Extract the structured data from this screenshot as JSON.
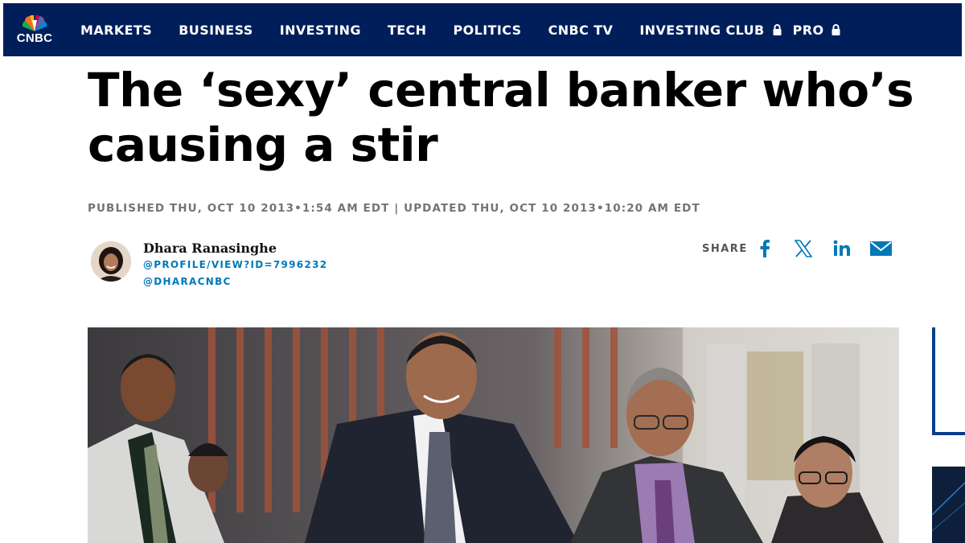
{
  "brand": {
    "logo_text": "CNBC"
  },
  "nav": {
    "items": [
      {
        "label": "MARKETS",
        "locked": false
      },
      {
        "label": "BUSINESS",
        "locked": false
      },
      {
        "label": "INVESTING",
        "locked": false
      },
      {
        "label": "TECH",
        "locked": false
      },
      {
        "label": "POLITICS",
        "locked": false
      },
      {
        "label": "CNBC TV",
        "locked": false
      },
      {
        "label": "INVESTING CLUB",
        "locked": true
      },
      {
        "label": "PRO",
        "locked": true
      }
    ]
  },
  "article": {
    "headline_line1": "The ‘sexy’ central banker who’s",
    "headline_line2": "causing a stir",
    "timestamps": "PUBLISHED THU, OCT 10 2013•1:54 AM EDT | UPDATED THU, OCT 10 2013•10:20 AM EDT",
    "author": {
      "name": "Dhara Ranasinghe",
      "profile_link": "@PROFILE/VIEW?ID=7996232",
      "handle": "@DHARACNBC"
    }
  },
  "share": {
    "label": "SHARE",
    "buttons": [
      "facebook-icon",
      "x-icon",
      "linkedin-icon",
      "email-icon"
    ]
  },
  "colors": {
    "nav_bg": "#001e5a",
    "link_blue": "#0079b8",
    "share_blue": "#0079b8",
    "timestamp_gray": "#747474"
  }
}
